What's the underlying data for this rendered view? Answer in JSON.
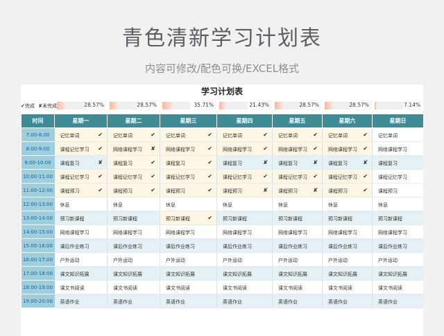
{
  "header": {
    "title": "青色清新学习计划表",
    "subtitle": "内容可修改/配色可换/EXCEL格式"
  },
  "sheet": {
    "title": "学习计划表",
    "legend": {
      "done": "✔完成",
      "undone": "✘未完成"
    },
    "progress": [
      {
        "value": 0.2857,
        "label": "28.57%"
      },
      {
        "value": 0.2857,
        "label": "28.57%"
      },
      {
        "value": 0.3571,
        "label": "35.71%"
      },
      {
        "value": 0.2143,
        "label": "21.43%"
      },
      {
        "value": 0.2857,
        "label": "28.57%"
      },
      {
        "value": 0.2857,
        "label": "28.57%"
      },
      {
        "value": 0.0714,
        "label": "7.14%"
      }
    ],
    "columns": [
      "时间",
      "星期一",
      "星期二",
      "星期三",
      "星期四",
      "星期五",
      "星期六",
      "星期日"
    ],
    "rows": [
      {
        "time": "7:00-8:00",
        "style": "yellow",
        "cells": [
          [
            "记忆单词",
            "✔"
          ],
          [
            "记忆单词",
            "✔"
          ],
          [
            "记忆单词",
            "✔"
          ],
          [
            "记忆单词",
            "✔"
          ],
          [
            "记忆单词",
            "✔"
          ],
          [
            "记忆单词",
            "✔"
          ],
          [
            "记忆单词",
            ""
          ]
        ]
      },
      {
        "time": "8:00-9:00",
        "style": "yellow",
        "cells": [
          [
            "课程记忆学习",
            "✔"
          ],
          [
            "网络课程学习",
            "✘"
          ],
          [
            "网络课程学习",
            "✔"
          ],
          [
            "网络课程学习",
            "✔"
          ],
          [
            "网络课程学习",
            "✔"
          ],
          [
            "网络课程学习",
            "✔"
          ],
          [
            "网络课程学习",
            ""
          ]
        ]
      },
      {
        "time": "9:00-10:00",
        "style": "blue",
        "cells": [
          [
            "课程复习",
            "✘"
          ],
          [
            "课程复习",
            "✔"
          ],
          [
            "课程复习",
            "✔"
          ],
          [
            "课程复习",
            "✘"
          ],
          [
            "课程复习",
            "✘"
          ],
          [
            "课程复习",
            "✘"
          ],
          [
            "课程复习",
            ""
          ]
        ]
      },
      {
        "time": "10:00-11:00",
        "style": "yellow",
        "cells": [
          [
            "课程记忆学习",
            "✔"
          ],
          [
            "课程记忆学习",
            "✔"
          ],
          [
            "课程记忆学习",
            "✔"
          ],
          [
            "课程记忆学习",
            "✔"
          ],
          [
            "课程记忆学习",
            "✔"
          ],
          [
            "课程记忆学习",
            "✔"
          ],
          [
            "课程记忆学习",
            ""
          ]
        ]
      },
      {
        "time": "11:00-12:00",
        "style": "yellow",
        "cells": [
          [
            "课程预习",
            "✔"
          ],
          [
            "课程预习",
            "✔"
          ],
          [
            "课程预习",
            "✔"
          ],
          [
            "课程预习",
            "✘"
          ],
          [
            "课程预习",
            "✘"
          ],
          [
            "课程预习",
            "✔"
          ],
          [
            "课程预习",
            ""
          ]
        ]
      },
      {
        "time": "12:00-13:00",
        "style": "white",
        "cells": [
          [
            "休息",
            ""
          ],
          [
            "休息",
            ""
          ],
          [
            "休息",
            ""
          ],
          [
            "休息",
            ""
          ],
          [
            "休息",
            ""
          ],
          [
            "休息",
            ""
          ],
          [
            "休息",
            ""
          ]
        ]
      },
      {
        "time": "13:00-14:00",
        "style": "blue",
        "cells": [
          [
            "预习新课程",
            ""
          ],
          [
            "预习新课程",
            ""
          ],
          [
            "预习新课程",
            "✔"
          ],
          [
            "预习新课程",
            ""
          ],
          [
            "预习新课程",
            ""
          ],
          [
            "预习新课程",
            ""
          ],
          [
            "预习新课程",
            ""
          ]
        ]
      },
      {
        "time": "14:00-15:00",
        "style": "white",
        "cells": [
          [
            "网络课程学习",
            ""
          ],
          [
            "网络课程学习",
            ""
          ],
          [
            "网络课程学习",
            ""
          ],
          [
            "网络课程学习",
            ""
          ],
          [
            "网络课程学习",
            ""
          ],
          [
            "网络课程学习",
            ""
          ],
          [
            "网络课程学习",
            ""
          ]
        ]
      },
      {
        "time": "15:00-16:00",
        "style": "blue",
        "cells": [
          [
            "课后作业练习",
            ""
          ],
          [
            "课后作业练习",
            ""
          ],
          [
            "课后作业练习",
            ""
          ],
          [
            "课后作业练习",
            ""
          ],
          [
            "课后作业练习",
            ""
          ],
          [
            "课后作业练习",
            ""
          ],
          [
            "课后作业练习",
            ""
          ]
        ]
      },
      {
        "time": "16:00-17:00",
        "style": "white",
        "cells": [
          [
            "户外运动",
            ""
          ],
          [
            "户外运动",
            ""
          ],
          [
            "户外运动",
            ""
          ],
          [
            "户外运动",
            ""
          ],
          [
            "户外运动",
            ""
          ],
          [
            "户外运动",
            ""
          ],
          [
            "户外运动",
            ""
          ]
        ]
      },
      {
        "time": "17:00-18:00",
        "style": "blue",
        "cells": [
          [
            "课文知识拓展",
            ""
          ],
          [
            "课文知识拓展",
            ""
          ],
          [
            "课文知识拓展",
            ""
          ],
          [
            "课文知识拓展",
            ""
          ],
          [
            "课文知识拓展",
            ""
          ],
          [
            "课文知识拓展",
            ""
          ],
          [
            "课文知识拓展",
            ""
          ]
        ]
      },
      {
        "time": "18:00-19:00",
        "style": "white",
        "cells": [
          [
            "课文书阅读",
            ""
          ],
          [
            "课文书阅读",
            ""
          ],
          [
            "课文书阅读",
            ""
          ],
          [
            "课文书阅读",
            ""
          ],
          [
            "课文书阅读",
            ""
          ],
          [
            "课文书阅读",
            ""
          ],
          [
            "课文书阅读",
            ""
          ]
        ]
      },
      {
        "time": "19:00-20:00",
        "style": "blue",
        "cells": [
          [
            "英语作业",
            ""
          ],
          [
            "英语作业",
            ""
          ],
          [
            "英语作业",
            ""
          ],
          [
            "英语作业",
            ""
          ],
          [
            "英语作业",
            ""
          ],
          [
            "英语作业",
            ""
          ],
          [
            "英语作业",
            ""
          ]
        ]
      }
    ]
  }
}
